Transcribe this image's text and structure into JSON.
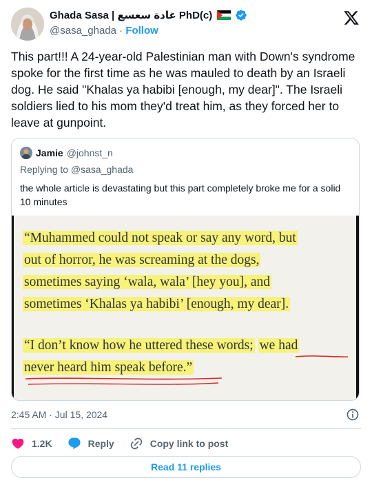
{
  "author": {
    "display_name": "Ghada Sasa | غادة سعسع PhD(c)",
    "handle": "@sasa_ghada",
    "separator": "·",
    "follow_label": "Follow"
  },
  "tweet": {
    "text": "This part!!! A 24-year-old Palestinian man with Down's syndrome spoke for the first time as he was mauled to death by an Israeli dog. He said \"Khalas ya habibi [enough, my dear]\". The Israeli soldiers lied to his mom they'd treat him, as they forced her to leave at gunpoint.",
    "timestamp": "2:45 AM · Jul 15, 2024"
  },
  "quote": {
    "name": "Jamie",
    "handle": "@johnst_n",
    "replying_to": "Replying to @sasa_ghada",
    "text": "the whole article is devastating but this part completely broke me for a solid 10 minutes",
    "image_lines": [
      "“Muhammed could not speak or say any word, but",
      "out of horror, he was screaming at the dogs,",
      "sometimes saying ‘wala, wala’ [hey you], and",
      "sometimes ‘Khalas ya habibi’ [enough, my dear].",
      "“I don’t know how he uttered these words;",
      "we had",
      "never heard him speak before.”"
    ]
  },
  "actions": {
    "likes": "1.2K",
    "reply_label": "Reply",
    "copy_label": "Copy link to post",
    "read_replies": "Read 11 replies"
  },
  "colors": {
    "accent": "#1d9bf0",
    "like": "#f91880",
    "highlight": "#f6f27a",
    "underline": "#d62828"
  }
}
